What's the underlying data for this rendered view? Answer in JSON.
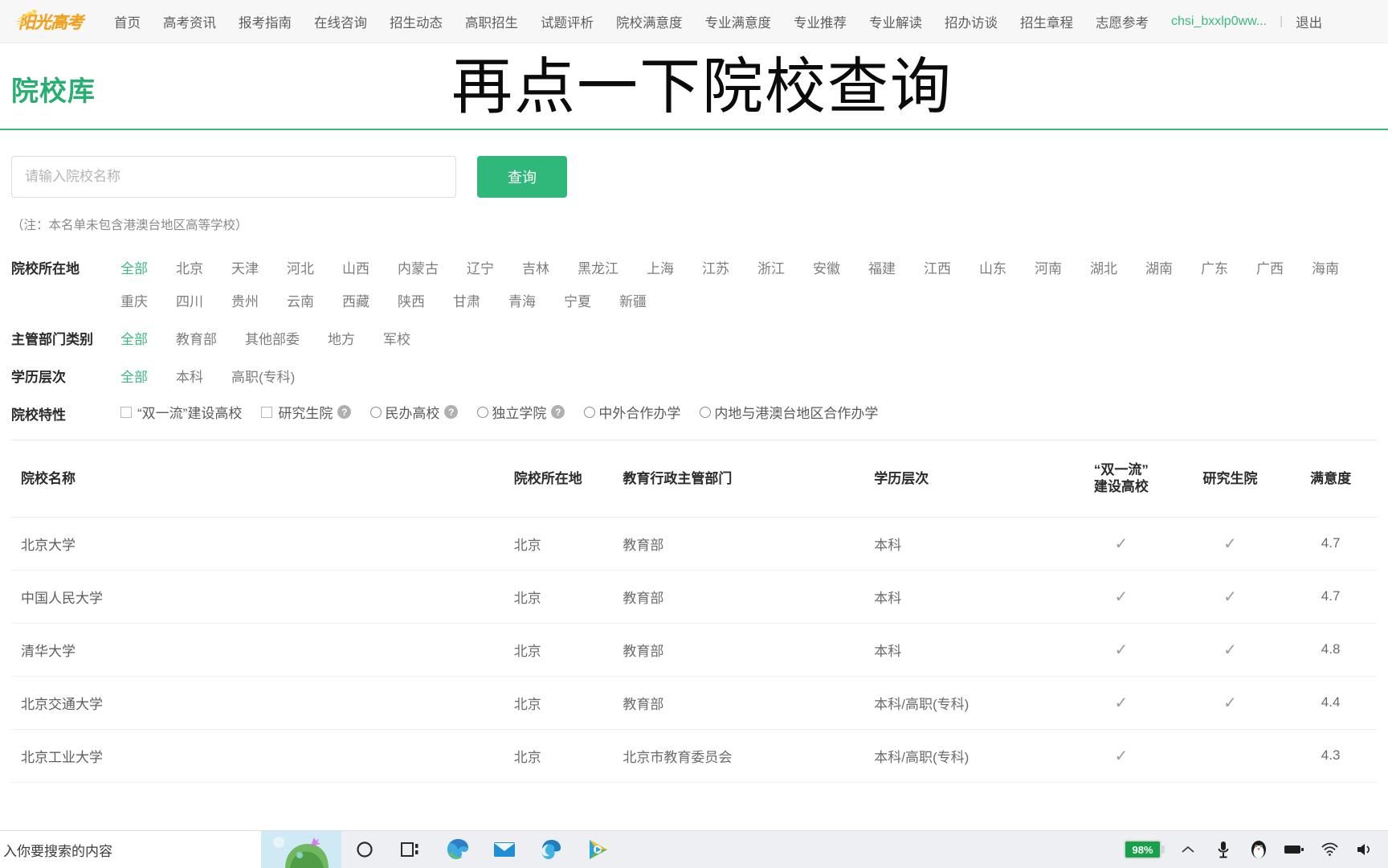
{
  "nav": {
    "logo_text": "阳光高考",
    "items": [
      {
        "label": "首页"
      },
      {
        "label": "高考资讯"
      },
      {
        "label": "报考指南"
      },
      {
        "label": "在线咨询"
      },
      {
        "label": "招生动态"
      },
      {
        "label": "高职招生"
      },
      {
        "label": "试题评析"
      },
      {
        "label": "院校满意度"
      },
      {
        "label": "专业满意度"
      },
      {
        "label": "专业推荐"
      },
      {
        "label": "专业解读"
      },
      {
        "label": "招办访谈"
      },
      {
        "label": "招生章程"
      },
      {
        "label": "志愿参考"
      }
    ],
    "username": "chsi_bxxlp0ww...",
    "separator": "|",
    "logout": "退出"
  },
  "header": {
    "page_title": "院校库",
    "overlay_text": "再点一下院校查询"
  },
  "search": {
    "placeholder": "请输入院校名称",
    "value": "",
    "button_label": "查询",
    "note": "（注：本名单未包含港澳台地区高等学校）"
  },
  "filters": {
    "location": {
      "label": "院校所在地",
      "options": [
        "全部",
        "北京",
        "天津",
        "河北",
        "山西",
        "内蒙古",
        "辽宁",
        "吉林",
        "黑龙江",
        "上海",
        "江苏",
        "浙江",
        "安徽",
        "福建",
        "江西",
        "山东",
        "河南",
        "湖北",
        "湖南",
        "广东",
        "广西",
        "海南",
        "重庆",
        "四川",
        "贵州",
        "云南",
        "西藏",
        "陕西",
        "甘肃",
        "青海",
        "宁夏",
        "新疆"
      ],
      "selected": "全部"
    },
    "department": {
      "label": "主管部门类别",
      "options": [
        "全部",
        "教育部",
        "其他部委",
        "地方",
        "军校"
      ],
      "selected": "全部"
    },
    "level": {
      "label": "学历层次",
      "options": [
        "全部",
        "本科",
        "高职(专科)"
      ],
      "selected": "全部"
    },
    "features": {
      "label": "院校特性",
      "items": [
        {
          "type": "checkbox",
          "label": "“双一流”建设高校",
          "checked": false,
          "help": false
        },
        {
          "type": "checkbox",
          "label": "研究生院",
          "checked": false,
          "help": true
        },
        {
          "type": "radio",
          "label": "民办高校",
          "checked": false,
          "help": true
        },
        {
          "type": "radio",
          "label": "独立学院",
          "checked": false,
          "help": true
        },
        {
          "type": "radio",
          "label": "中外合作办学",
          "checked": false,
          "help": false
        },
        {
          "type": "radio",
          "label": "内地与港澳台地区合作办学",
          "checked": false,
          "help": false
        }
      ]
    }
  },
  "table": {
    "columns": [
      "院校名称",
      "院校所在地",
      "教育行政主管部门",
      "学历层次",
      "“双一流”\n建设高校",
      "研究生院",
      "满意度"
    ],
    "columns_display": {
      "name": "院校名称",
      "location": "院校所在地",
      "department": "教育行政主管部门",
      "level": "学历层次",
      "first_class_line1": "“双一流”",
      "first_class_line2": "建设高校",
      "grad_school": "研究生院",
      "satisfaction": "满意度"
    },
    "check_glyph": "✓",
    "rows": [
      {
        "name": "北京大学",
        "location": "北京",
        "department": "教育部",
        "level": "本科",
        "first_class": true,
        "grad_school": true,
        "satisfaction": "4.7"
      },
      {
        "name": "中国人民大学",
        "location": "北京",
        "department": "教育部",
        "level": "本科",
        "first_class": true,
        "grad_school": true,
        "satisfaction": "4.7"
      },
      {
        "name": "清华大学",
        "location": "北京",
        "department": "教育部",
        "level": "本科",
        "first_class": true,
        "grad_school": true,
        "satisfaction": "4.8"
      },
      {
        "name": "北京交通大学",
        "location": "北京",
        "department": "教育部",
        "level": "本科/高职(专科)",
        "first_class": true,
        "grad_school": true,
        "satisfaction": "4.4"
      },
      {
        "name": "北京工业大学",
        "location": "北京",
        "department": "北京市教育委员会",
        "level": "本科/高职(专科)",
        "first_class": true,
        "grad_school": false,
        "satisfaction": "4.3"
      }
    ]
  },
  "taskbar": {
    "search_text": "入你要搜索的内容",
    "battery_percent": "98%",
    "icons": [
      {
        "name": "cortana-icon",
        "glyph": "◯"
      },
      {
        "name": "task-view-icon",
        "glyph": "❏"
      },
      {
        "name": "edge-chromium-icon",
        "glyph": "●"
      },
      {
        "name": "mail-icon",
        "glyph": "✉"
      },
      {
        "name": "edge-legacy-icon",
        "glyph": "e"
      },
      {
        "name": "media-player-icon",
        "glyph": "▶"
      }
    ],
    "tray": [
      {
        "name": "chevron-up-icon",
        "glyph": "︿"
      },
      {
        "name": "microphone-icon",
        "glyph": "🎤"
      },
      {
        "name": "qq-icon",
        "glyph": "🐧"
      },
      {
        "name": "battery-tray-icon",
        "glyph": "▬"
      },
      {
        "name": "wifi-icon",
        "glyph": "📶"
      },
      {
        "name": "volume-icon",
        "glyph": "🔊"
      }
    ]
  },
  "colors": {
    "brand_green": "#3cb882",
    "button_green": "#2fb87a",
    "logo_orange": "#f0a11e",
    "battery_green": "#18a04a"
  }
}
